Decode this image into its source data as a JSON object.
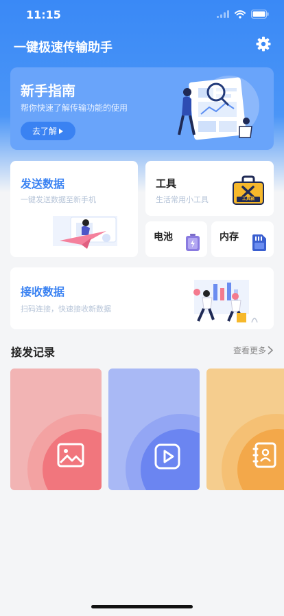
{
  "status_bar": {
    "time": "11:15"
  },
  "header": {
    "title": "一键极速传输助手",
    "settings_icon": "gear-icon"
  },
  "guide": {
    "title": "新手指南",
    "subtitle": "帮你快速了解传输功能的使用",
    "button_label": "去了解"
  },
  "send": {
    "title": "发送数据",
    "subtitle": "一键发送数据至新手机"
  },
  "tools": {
    "title": "工具",
    "subtitle": "生活常用小工具",
    "icon_label": "工具箱"
  },
  "battery": {
    "title": "电池"
  },
  "memory": {
    "title": "内存"
  },
  "receive": {
    "title": "接收数据",
    "subtitle": "扫码连接，快速接收新数据"
  },
  "records": {
    "title": "接发记录",
    "more_label": "查看更多",
    "tiles": [
      {
        "icon": "image-icon",
        "color": "#f2b4b4"
      },
      {
        "icon": "video-icon",
        "color": "#a9b9f5"
      },
      {
        "icon": "contacts-icon",
        "color": "#f5cd8e"
      }
    ]
  },
  "colors": {
    "primary": "#3a82f2",
    "background": "#f4f5f7"
  }
}
